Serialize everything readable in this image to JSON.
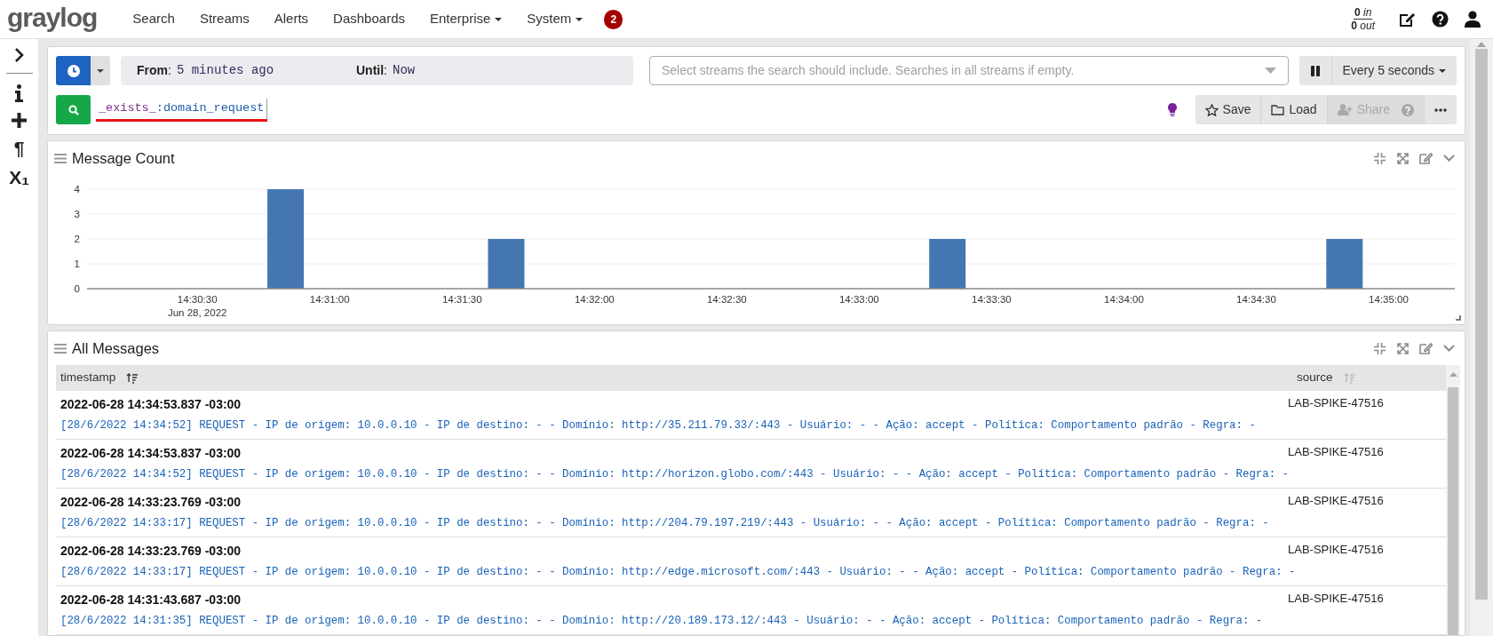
{
  "navbar": {
    "logo": "graylog",
    "items": [
      {
        "label": "Search",
        "dropdown": false
      },
      {
        "label": "Streams",
        "dropdown": false
      },
      {
        "label": "Alerts",
        "dropdown": false
      },
      {
        "label": "Dashboards",
        "dropdown": false
      },
      {
        "label": "Enterprise",
        "dropdown": true
      },
      {
        "label": "System",
        "dropdown": true
      }
    ],
    "notification_count": "2",
    "throughput": {
      "in_count": "0",
      "in_label": "in",
      "out_count": "0",
      "out_label": "out"
    }
  },
  "sidebar": {
    "glyph_buttons": [
      "¶",
      "X₁"
    ]
  },
  "search_bar": {
    "from_label": "**From**:",
    "from_value": "5 minutes ago",
    "until_label": "**Until**:",
    "until_value": "Now",
    "streams_placeholder": "Select streams the search should include. Searches in all streams if empty.",
    "refresh_label": "Every 5 seconds",
    "query_tokens": [
      {
        "text": "_exists_",
        "color": "#7b2d8e"
      },
      {
        "text": ":domain_request",
        "color": "#1f5ea8"
      }
    ],
    "query_underlined": true,
    "actions": [
      {
        "kind": "save",
        "label": "Save",
        "disabled": false
      },
      {
        "kind": "load",
        "label": "Load",
        "disabled": false
      },
      {
        "kind": "share",
        "label": "Share",
        "disabled": true
      },
      {
        "kind": "more",
        "disabled": false
      }
    ]
  },
  "message_count": {
    "title": "Message Count",
    "chart_data": {
      "type": "bar",
      "categories": [
        null,
        null,
        "14:30:30\nJun 28, 2022",
        null,
        null,
        "14:31:00",
        null,
        null,
        "14:31:30",
        null,
        null,
        "14:32:00",
        null,
        null,
        "14:32:30",
        null,
        null,
        "14:33:00",
        null,
        null,
        "14:33:30",
        null,
        null,
        "14:34:00",
        null,
        null,
        "14:34:30",
        null,
        null,
        "14:35:00",
        null
      ],
      "values": [
        0,
        0,
        0,
        0,
        4,
        0,
        0,
        0,
        0,
        2,
        0,
        0,
        0,
        0,
        0,
        0,
        0,
        0,
        0,
        2,
        0,
        0,
        0,
        0,
        0,
        0,
        0,
        0,
        2,
        0,
        0
      ],
      "ylim": [
        0,
        4
      ],
      "grid": true,
      "yticks": [
        0,
        1,
        2,
        3,
        4
      ]
    }
  },
  "all_messages": {
    "title": "All Messages",
    "columns": [
      {
        "label": "timestamp"
      },
      {
        "label": "source"
      }
    ],
    "rows": [
      {
        "timestamp": "2022-06-28 14:34:53.837 -03:00",
        "message": "[28/6/2022 14:34:52] REQUEST - IP de origem: 10.0.0.10 - IP de destino: - - Domínio: http://35.211.79.33/:443 - Usuário: - - Ação: accept - Política: Comportamento padrão - Regra: -",
        "source": "LAB-SPIKE-47516"
      },
      {
        "timestamp": "2022-06-28 14:34:53.837 -03:00",
        "message": "[28/6/2022 14:34:52] REQUEST - IP de origem: 10.0.0.10 - IP de destino: - - Domínio: http://horizon.globo.com/:443 - Usuário: - - Ação: accept - Política: Comportamento padrão - Regra: -",
        "source": "LAB-SPIKE-47516"
      },
      {
        "timestamp": "2022-06-28 14:33:23.769 -03:00",
        "message": "[28/6/2022 14:33:17] REQUEST - IP de origem: 10.0.0.10 - IP de destino: - - Domínio: http://204.79.197.219/:443 - Usuário: - - Ação: accept - Política: Comportamento padrão - Regra: -",
        "source": "LAB-SPIKE-47516"
      },
      {
        "timestamp": "2022-06-28 14:33:23.769 -03:00",
        "message": "[28/6/2022 14:33:17] REQUEST - IP de origem: 10.0.0.10 - IP de destino: - - Domínio: http://edge.microsoft.com/:443 - Usuário: - - Ação: accept - Política: Comportamento padrão - Regra: -",
        "source": "LAB-SPIKE-47516"
      },
      {
        "timestamp": "2022-06-28 14:31:43.687 -03:00",
        "message": "[28/6/2022 14:31:35] REQUEST - IP de origem: 10.0.0.10 - IP de destino: - - Domínio: http://20.189.173.12/:443 - Usuário: - - Ação: accept - Política: Comportamento padrão - Regra: -",
        "source": "LAB-SPIKE-47516"
      }
    ]
  }
}
